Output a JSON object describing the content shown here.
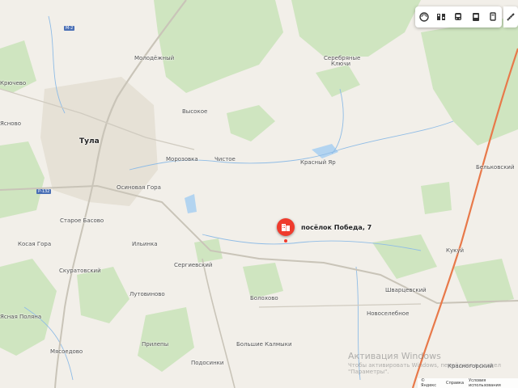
{
  "map": {
    "labels": {
      "molodezhny": "Молодёжный",
      "seryebryanye_klyuchi": "Серебряные Ключи",
      "kryuchevo": "Крючево",
      "osinovaya_gora": "Осиновая Гора",
      "tula": "Тула",
      "vysokoe": "Высокое",
      "morozovka": "Морозовка",
      "chistoe": "Чистое",
      "krasny_yar": "Красный Яр",
      "belkovsky": "Бельковский",
      "staroe_basovo": "Старое Басово",
      "kosaya_gora": "Косая Гора",
      "ilyinka": "Ильинка",
      "sergievsky": "Сергиевский",
      "kukuy": "Кукуй",
      "skuratovsky": "Скуратовский",
      "lutovinovo": "Лутовиново",
      "bolokhovo": "Болохово",
      "shvarovsky": "Шварцевский",
      "novoselebnoe": "Новоселебное",
      "yasnaya_polyana": "Ясная Поляна",
      "mosedovo": "Мясоедово",
      "prileptsy": "Прилепы",
      "bolshie_kalmyki": "Большие Калмыки",
      "podosinki": "Подосинки",
      "krasnogorsky": "Красногорский",
      "yanovo": "Ясново"
    },
    "road_shields": {
      "m2": "М-2",
      "p132": "Р-132"
    },
    "marker": {
      "label": "посёлок Победа, 7",
      "icon": "building-icon",
      "color": "#ef3b2d"
    }
  },
  "toolbar": {
    "items": [
      "layers-icon",
      "traffic-icon",
      "transit-icon",
      "bus-icon",
      "panorama-icon"
    ],
    "ruler": "ruler-icon"
  },
  "watermark": {
    "line1": "Активация Windows",
    "line2": "Чтобы активировать Windows, перейдите в раздел \"Параметры\"."
  },
  "footer": {
    "yandex": "© Яндекс",
    "help": "Справка",
    "terms": "Условия использования"
  }
}
